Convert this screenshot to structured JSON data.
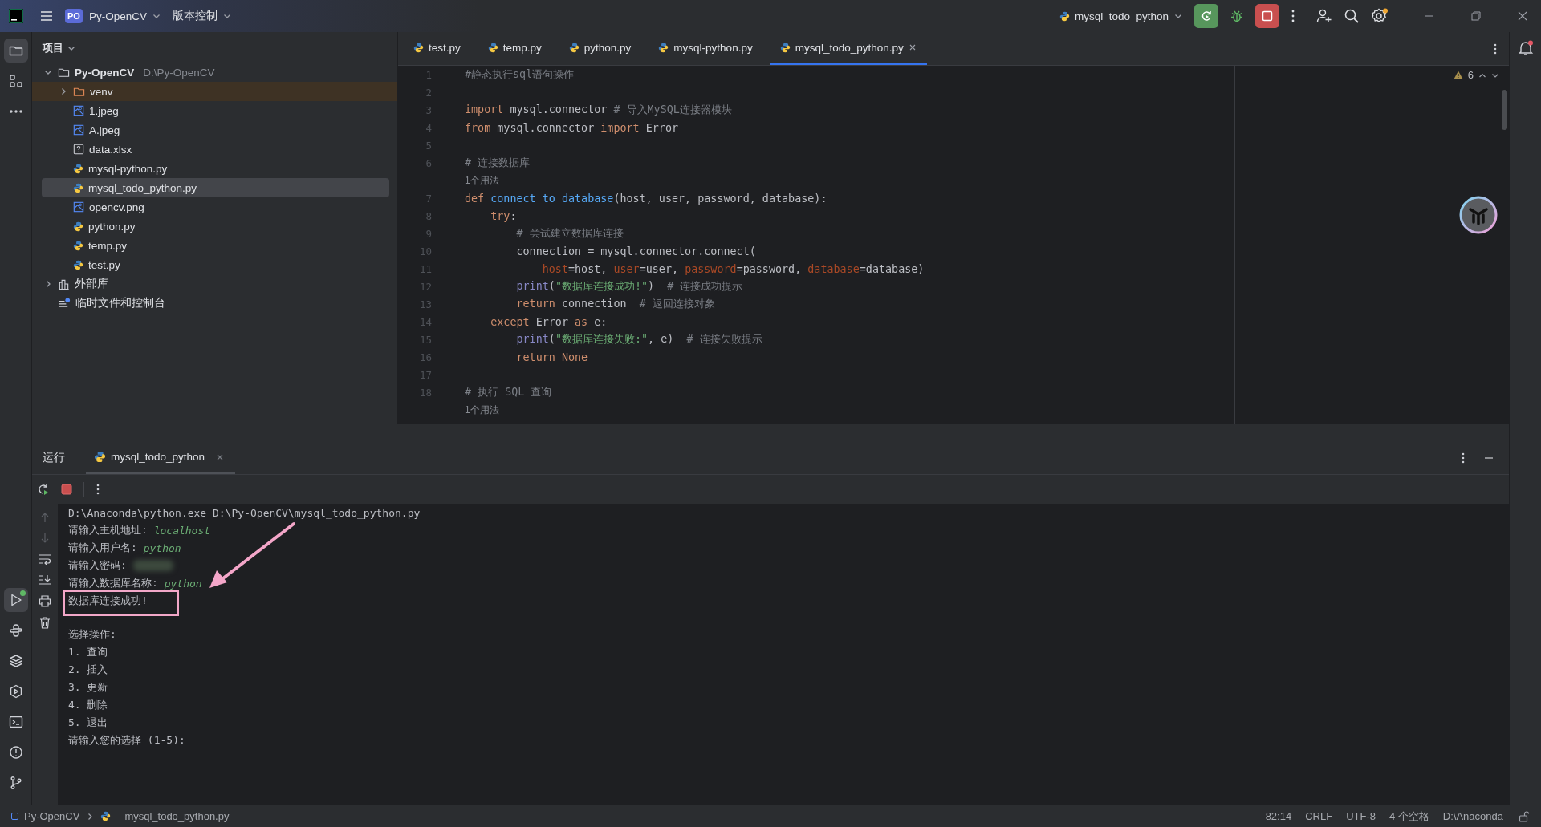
{
  "title_bar": {
    "project_badge": "PO",
    "project": "Py-OpenCV",
    "vcs_menu": "版本控制",
    "run_config": "mysql_todo_python"
  },
  "tool_strip": {
    "top": [
      {
        "kind": "project",
        "selected": true,
        "running": false
      },
      {
        "kind": "structure",
        "selected": false,
        "running": false
      },
      {
        "kind": "more",
        "selected": false,
        "running": false
      }
    ],
    "bottom": [
      {
        "kind": "run",
        "selected": true,
        "running": true
      },
      {
        "kind": "python-console",
        "selected": false,
        "running": false
      },
      {
        "kind": "layers",
        "selected": false,
        "running": false
      },
      {
        "kind": "services",
        "selected": false,
        "running": false
      },
      {
        "kind": "terminal",
        "selected": false,
        "running": false
      },
      {
        "kind": "problems",
        "selected": false,
        "running": false
      },
      {
        "kind": "git",
        "selected": false,
        "running": false
      }
    ]
  },
  "project_panel": {
    "title": "项目",
    "tree": [
      {
        "label": "Py-OpenCV",
        "path": "D:\\Py-OpenCV",
        "kind": "folder",
        "expanded": true,
        "selected": false,
        "children": [
          {
            "label": "venv",
            "kind": "excluded-folder",
            "expanded": false,
            "selected": false
          },
          {
            "label": "1.jpeg",
            "kind": "image",
            "selected": false
          },
          {
            "label": "A.jpeg",
            "kind": "image",
            "selected": false
          },
          {
            "label": "data.xlsx",
            "kind": "unknown",
            "selected": false
          },
          {
            "label": "mysql-python.py",
            "kind": "python",
            "selected": false
          },
          {
            "label": "mysql_todo_python.py",
            "kind": "python",
            "selected": true
          },
          {
            "label": "opencv.png",
            "kind": "image",
            "selected": false
          },
          {
            "label": "python.py",
            "kind": "python",
            "selected": false
          },
          {
            "label": "temp.py",
            "kind": "python",
            "selected": false
          },
          {
            "label": "test.py",
            "kind": "python",
            "selected": false
          }
        ]
      },
      {
        "label": "外部库",
        "kind": "library",
        "expanded": false,
        "selected": false
      },
      {
        "label": "临时文件和控制台",
        "kind": "scratch",
        "selected": false
      }
    ]
  },
  "editor": {
    "tabs": [
      {
        "label": "test.py",
        "selected": false
      },
      {
        "label": "temp.py",
        "selected": false
      },
      {
        "label": "python.py",
        "selected": false
      },
      {
        "label": "mysql-python.py",
        "selected": false
      },
      {
        "label": "mysql_todo_python.py",
        "selected": true
      }
    ],
    "warnings": "6",
    "lines": [
      {
        "kind": "code",
        "number": "1",
        "tokens": [
          {
            "kind": "comment",
            "text": "#静态执行sql语句操作"
          }
        ]
      },
      {
        "kind": "code",
        "number": "2"
      },
      {
        "kind": "code",
        "number": "3",
        "tokens": [
          {
            "kind": "keyword",
            "text": "import"
          },
          {
            "kind": "plain",
            "text": " mysql.connector "
          },
          {
            "kind": "comment",
            "text": "# 导入MySQL连接器模块"
          }
        ]
      },
      {
        "kind": "code",
        "number": "4",
        "tokens": [
          {
            "kind": "keyword",
            "text": "from"
          },
          {
            "kind": "plain",
            "text": " mysql.connector "
          },
          {
            "kind": "keyword",
            "text": "import"
          },
          {
            "kind": "plain",
            "text": " Error"
          }
        ]
      },
      {
        "kind": "code",
        "number": "5"
      },
      {
        "kind": "code",
        "number": "6",
        "tokens": [
          {
            "kind": "comment",
            "text": "# 连接数据库"
          }
        ]
      },
      {
        "kind": "hint",
        "text": "1个用法"
      },
      {
        "kind": "code",
        "number": "7",
        "tokens": [
          {
            "kind": "keyword",
            "text": "def "
          },
          {
            "kind": "function",
            "text": "connect_to_database"
          },
          {
            "kind": "plain",
            "text": "(host, user, password, database):"
          }
        ]
      },
      {
        "kind": "code",
        "number": "8",
        "tokens": [
          {
            "kind": "keyword",
            "text": "    try"
          },
          {
            "kind": "plain",
            "text": ":"
          }
        ]
      },
      {
        "kind": "code",
        "number": "9",
        "tokens": [
          {
            "kind": "comment",
            "text": "        # 尝试建立数据库连接"
          }
        ]
      },
      {
        "kind": "code",
        "number": "10",
        "tokens": [
          {
            "kind": "plain",
            "text": "        connection = mysql.connector.connect("
          }
        ]
      },
      {
        "kind": "code",
        "number": "11",
        "tokens": [
          {
            "kind": "named",
            "text": "            host"
          },
          {
            "kind": "plain",
            "text": "=host, "
          },
          {
            "kind": "named",
            "text": "user"
          },
          {
            "kind": "plain",
            "text": "=user, "
          },
          {
            "kind": "named",
            "text": "password"
          },
          {
            "kind": "plain",
            "text": "=password, "
          },
          {
            "kind": "named",
            "text": "database"
          },
          {
            "kind": "plain",
            "text": "=database)"
          }
        ]
      },
      {
        "kind": "code",
        "number": "12",
        "tokens": [
          {
            "kind": "builtin",
            "text": "        print"
          },
          {
            "kind": "plain",
            "text": "("
          },
          {
            "kind": "string",
            "text": "\"数据库连接成功!\""
          },
          {
            "kind": "plain",
            "text": ")  "
          },
          {
            "kind": "comment",
            "text": "# 连接成功提示"
          }
        ]
      },
      {
        "kind": "code",
        "number": "13",
        "tokens": [
          {
            "kind": "keyword",
            "text": "        return"
          },
          {
            "kind": "plain",
            "text": " connection  "
          },
          {
            "kind": "comment",
            "text": "# 返回连接对象"
          }
        ]
      },
      {
        "kind": "code",
        "number": "14",
        "tokens": [
          {
            "kind": "keyword",
            "text": "    except"
          },
          {
            "kind": "plain",
            "text": " Error "
          },
          {
            "kind": "keyword",
            "text": "as"
          },
          {
            "kind": "plain",
            "text": " e:"
          }
        ]
      },
      {
        "kind": "code",
        "number": "15",
        "tokens": [
          {
            "kind": "builtin",
            "text": "        print"
          },
          {
            "kind": "plain",
            "text": "("
          },
          {
            "kind": "string",
            "text": "\"数据库连接失败:\""
          },
          {
            "kind": "plain",
            "text": ", e)  "
          },
          {
            "kind": "comment",
            "text": "# 连接失败提示"
          }
        ]
      },
      {
        "kind": "code",
        "number": "16",
        "tokens": [
          {
            "kind": "keyword",
            "text": "        return None"
          }
        ]
      },
      {
        "kind": "code",
        "number": "17"
      },
      {
        "kind": "code",
        "number": "18",
        "tokens": [
          {
            "kind": "comment",
            "text": "# 执行 SQL 查询"
          }
        ]
      },
      {
        "kind": "hint",
        "text": "1个用法"
      }
    ]
  },
  "run_panel": {
    "title": "运行",
    "tabs": [
      {
        "label": "mysql_todo_python",
        "selected": true
      }
    ],
    "console": [
      {
        "kind": "text",
        "highlighted": false,
        "segments": [
          {
            "kind": "output",
            "text": "D:\\Anaconda\\python.exe D:\\Py-OpenCV\\mysql_todo_python.py"
          }
        ]
      },
      {
        "kind": "text",
        "highlighted": false,
        "segments": [
          {
            "kind": "output",
            "text": "请输入主机地址: "
          },
          {
            "kind": "input",
            "text": "localhost"
          }
        ]
      },
      {
        "kind": "text",
        "highlighted": false,
        "segments": [
          {
            "kind": "output",
            "text": "请输入用户名: "
          },
          {
            "kind": "input",
            "text": "python"
          }
        ]
      },
      {
        "kind": "text",
        "highlighted": false,
        "segments": [
          {
            "kind": "output",
            "text": "请输入密码: "
          },
          {
            "kind": "redacted"
          }
        ]
      },
      {
        "kind": "text",
        "highlighted": false,
        "segments": [
          {
            "kind": "output",
            "text": "请输入数据库名称: "
          },
          {
            "kind": "input",
            "text": "python"
          }
        ]
      },
      {
        "kind": "text",
        "highlighted": true,
        "segments": [
          {
            "kind": "output",
            "text": "数据库连接成功!"
          }
        ]
      },
      {
        "kind": "blank"
      },
      {
        "kind": "text",
        "highlighted": false,
        "segments": [
          {
            "kind": "output",
            "text": "选择操作:"
          }
        ]
      },
      {
        "kind": "text",
        "highlighted": false,
        "segments": [
          {
            "kind": "output",
            "text": "1. 查询"
          }
        ]
      },
      {
        "kind": "text",
        "highlighted": false,
        "segments": [
          {
            "kind": "output",
            "text": "2. 插入"
          }
        ]
      },
      {
        "kind": "text",
        "highlighted": false,
        "segments": [
          {
            "kind": "output",
            "text": "3. 更新"
          }
        ]
      },
      {
        "kind": "text",
        "highlighted": false,
        "segments": [
          {
            "kind": "output",
            "text": "4. 删除"
          }
        ]
      },
      {
        "kind": "text",
        "highlighted": false,
        "segments": [
          {
            "kind": "output",
            "text": "5. 退出"
          }
        ]
      },
      {
        "kind": "text",
        "highlighted": false,
        "segments": [
          {
            "kind": "output",
            "text": "请输入您的选择 (1-5):"
          }
        ]
      }
    ]
  },
  "status_bar": {
    "breadcrumbs": [
      "Py-OpenCV",
      "mysql_todo_python.py"
    ],
    "position": "82:14",
    "line_separator": "CRLF",
    "encoding": "UTF-8",
    "indent": "4 个空格",
    "interpreter": "D:\\Anaconda"
  }
}
